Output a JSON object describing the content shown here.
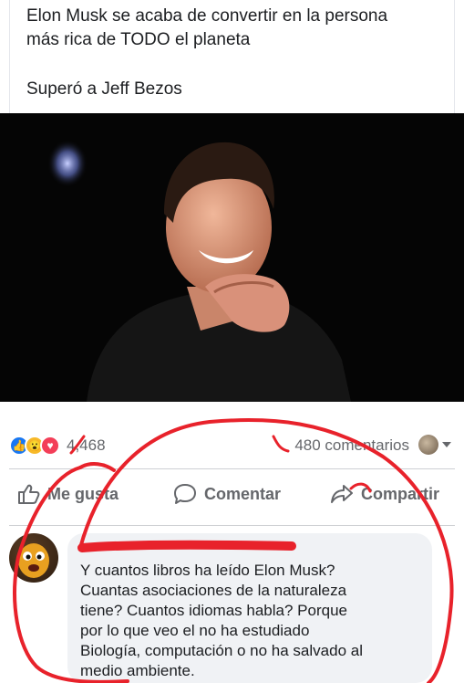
{
  "post": {
    "text_lines": [
      "Elon Musk se acaba de convertir en la persona",
      "más rica de TODO el planeta",
      "Superó a Jeff Bezos"
    ]
  },
  "stats": {
    "reaction_count": "4,468",
    "comments_count": "480 comentarios"
  },
  "actions": {
    "like": "Me gusta",
    "comment": "Comentar",
    "share": "Compartir"
  },
  "comment": {
    "lines": [
      "Y cuantos libros ha leído Elon Musk?",
      "Cuantas asociaciones de la naturaleza",
      "tiene? Cuantos idiomas habla? Porque",
      "por lo que veo el no ha estudiado",
      "Biología, computación o no ha salvado al",
      "medio ambiente."
    ]
  },
  "colors": {
    "like_blue": "#1877f2",
    "annotation_red": "#e8222b",
    "secondary_text": "#65676b"
  }
}
